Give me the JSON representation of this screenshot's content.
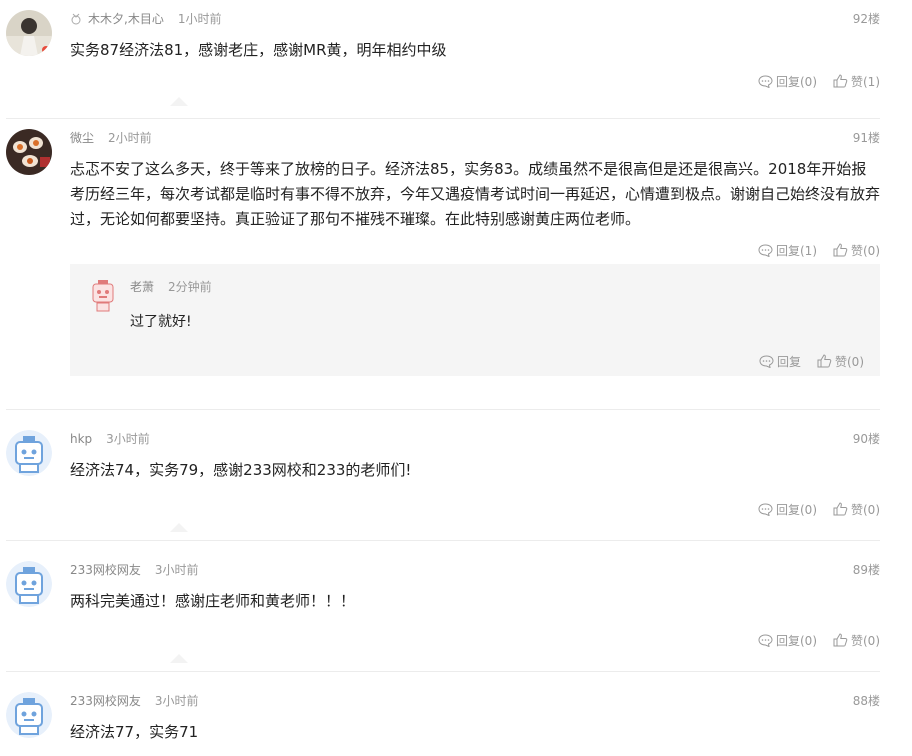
{
  "comments": [
    {
      "name": "木木夕,木目心",
      "time": "1小时前",
      "floor": "92楼",
      "text": "实务87经济法81，感谢老庄，感谢MR黄，明年相约中级",
      "reply_label": "回复(0)",
      "like_label": "赞(1)",
      "has_medal": true
    },
    {
      "name": "微尘",
      "time": "2小时前",
      "floor": "91楼",
      "text": "忐忑不安了这么多天，终于等来了放榜的日子。经济法85，实务83。成绩虽然不是很高但是还是很高兴。2018年开始报考历经三年，每次考试都是临时有事不得不放弃，今年又遇疫情考试时间一再延迟，心情遭到极点。谢谢自己始终没有放弃过，无论如何都要坚持。真正验证了那句不摧残不璀璨。在此特别感谢黄庄两位老师。",
      "reply_label": "回复(1)",
      "like_label": "赞(0)",
      "nested": {
        "name": "老萧",
        "time": "2分钟前",
        "text": "过了就好!",
        "reply_label": "回复",
        "like_label": "赞(0)"
      }
    },
    {
      "name": "hkp",
      "time": "3小时前",
      "floor": "90楼",
      "text": "经济法74，实务79，感谢233网校和233的老师们!",
      "reply_label": "回复(0)",
      "like_label": "赞(0)"
    },
    {
      "name": "233网校网友",
      "time": "3小时前",
      "floor": "89楼",
      "text": "两科完美通过！感谢庄老师和黄老师！！！",
      "reply_label": "回复(0)",
      "like_label": "赞(0)"
    },
    {
      "name": "233网校网友",
      "time": "3小时前",
      "floor": "88楼",
      "text": "经济法77，实务71"
    }
  ],
  "icons": {
    "reply": "comment-bubble-icon",
    "like": "thumbs-up-icon",
    "medal": "medal-icon"
  }
}
